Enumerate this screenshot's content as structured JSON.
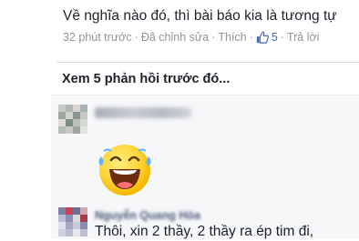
{
  "top_comment": {
    "text": "Về nghĩa nào đó, thì bài báo kia là tương tự",
    "time": "32 phút trước",
    "edited": "Đã chỉnh sửa",
    "like_action": "Thích",
    "like_count": "5",
    "reply_action": "Trả lời",
    "separator": "·"
  },
  "view_previous_replies": "Xem 5 phản hồi trước đó...",
  "replies": [
    {
      "name": "",
      "content_icon": "laughing-tears-emoji-icon",
      "text": ""
    },
    {
      "name": "Nguyễn Quang Hòa",
      "text": "Thôi, xin 2 thầy, 2 thầy ra ép tim đi,"
    }
  ],
  "colors": {
    "link_blue": "#4267b2",
    "meta_gray": "#90949c",
    "reply_background": "#f6f7f9",
    "divider": "#dddfe2"
  }
}
